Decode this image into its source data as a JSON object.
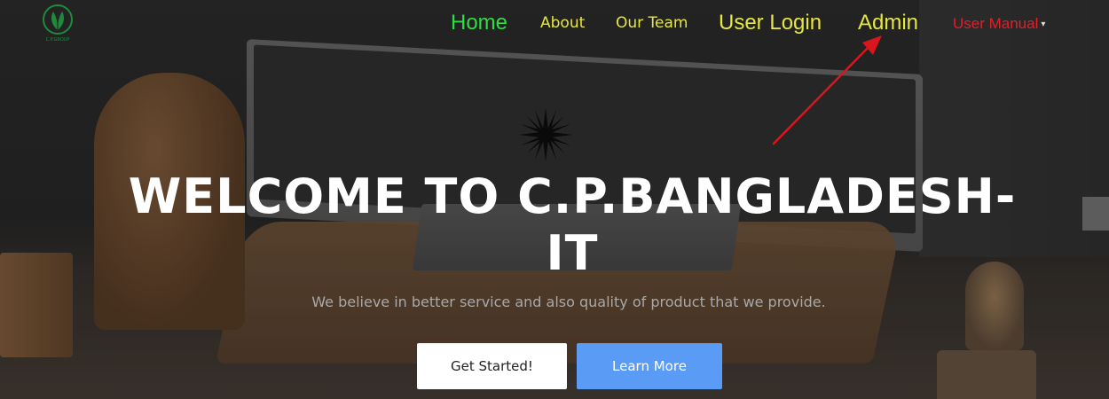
{
  "nav": {
    "home": "Home",
    "about": "About",
    "our_team": "Our Team",
    "user_login": "User Login",
    "admin": "Admin",
    "user_manual": "User Manual"
  },
  "logo": {
    "icon": "cp-group-leaf-logo",
    "caption": "C.P.GROUP",
    "color": "#1f8a3a"
  },
  "hero": {
    "title": "WELCOME TO C.P.BANGLADESH-IT",
    "subtitle": "We believe in better service and also quality of product that we provide.",
    "primary_button": "Get Started!",
    "secondary_button": "Learn More"
  },
  "colors": {
    "home_link": "#2ddd43",
    "nav_link": "#e6e640",
    "user_manual_link": "#e0202a",
    "learn_more_button": "#5a9bf6",
    "annotation_arrow": "#d9161d"
  }
}
